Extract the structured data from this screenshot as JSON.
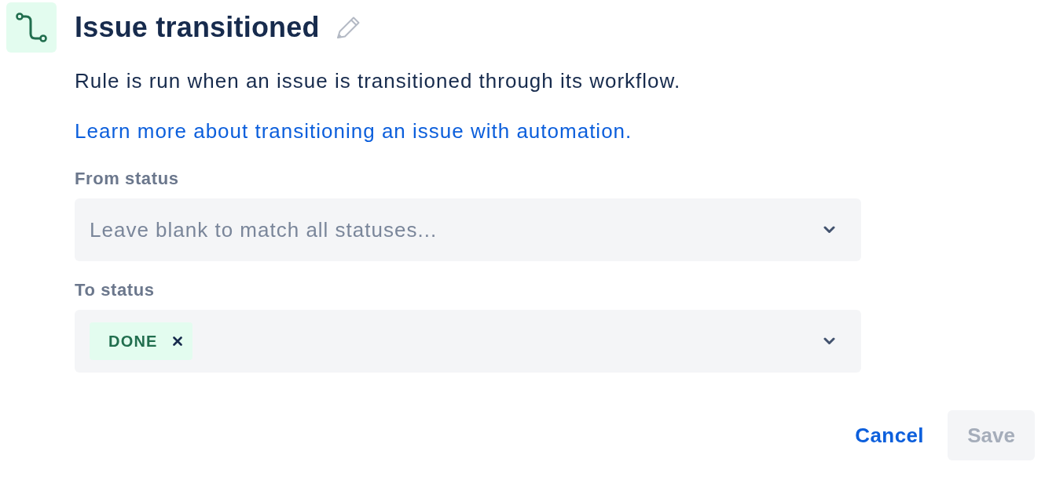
{
  "title": "Issue transitioned",
  "description": "Rule is run when an issue is transitioned through its workflow.",
  "link": "Learn more about transitioning an issue with automation.",
  "fields": [
    {
      "label": "From status",
      "placeholder": "Leave blank to match all statuses..."
    },
    {
      "label": "To status",
      "values": [
        {
          "label": "DONE"
        }
      ]
    }
  ],
  "buttons": [
    {
      "label": "Cancel",
      "kind": "link",
      "disabled": false
    },
    {
      "label": "Save",
      "kind": "primary",
      "disabled": true
    }
  ]
}
